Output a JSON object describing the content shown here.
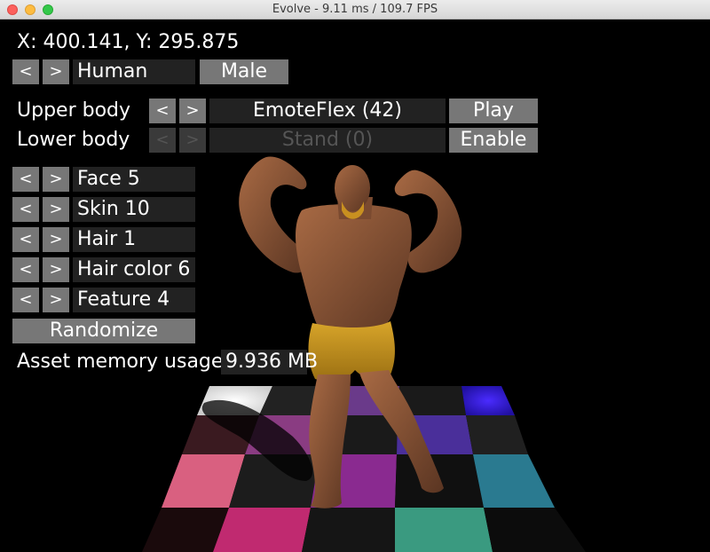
{
  "window": {
    "title": "Evolve - 9.11 ms / 109.7 FPS"
  },
  "hud": {
    "coords": "X: 400.141, Y: 295.875",
    "prev": "<",
    "next": ">",
    "race": "Human",
    "gender": "Male",
    "upper_body": {
      "label": "Upper body",
      "animation": "EmoteFlex (42)",
      "action": "Play"
    },
    "lower_body": {
      "label": "Lower body",
      "animation": "Stand (0)",
      "action": "Enable"
    },
    "options": [
      {
        "value": "Face 5"
      },
      {
        "value": "Skin 10"
      },
      {
        "value": "Hair 1"
      },
      {
        "value": "Hair color 6"
      },
      {
        "value": "Feature 4"
      }
    ],
    "randomize": "Randomize",
    "memory": {
      "label": "Asset memory usage:",
      "value": "9.936 MB"
    }
  },
  "colors": {
    "button": "#777777",
    "field": "#222222",
    "disabled_text": "#555555"
  },
  "scene": {
    "model": "bald muscular male flexing",
    "floor": "colored checkerboard plane"
  }
}
